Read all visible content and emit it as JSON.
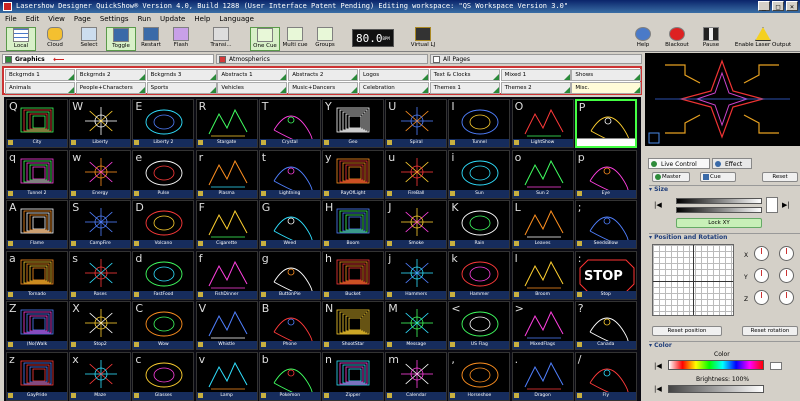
{
  "window": {
    "title": "Lasershow Designer QuickShow®    Version 4.0, Build 1288   (User Interface Patent Pending)   Editing workspace: \"QS Workspace Version 3.0\"",
    "controls": [
      "_",
      "□",
      "×"
    ]
  },
  "menu": [
    "File",
    "Edit",
    "View",
    "Page",
    "Settings",
    "Run",
    "Update",
    "Help",
    "Language"
  ],
  "toolbar": {
    "buttons": [
      {
        "name": "local-button",
        "label": "Local",
        "icon": "grid-icon",
        "active": true
      },
      {
        "name": "cloud-button",
        "label": "Cloud",
        "icon": "cloud-icon",
        "active": false
      },
      {
        "name": "select-button",
        "label": "Select",
        "icon": "cursor-icon",
        "active": false
      },
      {
        "name": "toggle-button",
        "label": "Toggle",
        "icon": "toggle-icon",
        "active": true
      },
      {
        "name": "restart-button",
        "label": "Restart",
        "icon": "restart-icon",
        "active": false
      },
      {
        "name": "flash-button",
        "label": "Flash",
        "icon": "flash-icon",
        "active": false
      },
      {
        "name": "transition-button",
        "label": "Transi...",
        "icon": "transition-icon",
        "active": false
      },
      {
        "name": "one-cue-button",
        "label": "One Cue",
        "icon": "one-cue-icon",
        "active": true
      },
      {
        "name": "multi-cue-button",
        "label": "Multi cue",
        "icon": "multi-cue-icon",
        "active": false
      },
      {
        "name": "groups-button",
        "label": "Groups",
        "icon": "groups-icon",
        "active": false
      }
    ],
    "bpm_value": "80.0",
    "bpm_unit": "BPM",
    "virtual_label": "Virtual LJ",
    "right_buttons": [
      {
        "name": "help-button",
        "label": "Help",
        "icon": "question-icon"
      },
      {
        "name": "blackout-button",
        "label": "Blackout",
        "icon": "blackout-icon"
      },
      {
        "name": "pause-button",
        "label": "Pause",
        "icon": "pause-icon"
      },
      {
        "name": "enable-laser-button",
        "label": "Enable Laser Output",
        "icon": "laser-warning-icon"
      }
    ]
  },
  "page_tabs": [
    {
      "label": "Graphics",
      "color": "#2e8b3a",
      "selected": true
    },
    {
      "label": "Atmospherics",
      "color": "#d43a3a",
      "selected": false
    },
    {
      "label": "All Pages",
      "color": "#ffffff",
      "selected": false
    }
  ],
  "categories": [
    [
      "Bckgrnds 1",
      "Bckgrnds 2",
      "Bckgrnds 3",
      "Abstracts 1",
      "Abstracts 2",
      "Logos",
      "Text & Clocks",
      "Mixed 1",
      "Shows"
    ],
    [
      "Animals",
      "People+Characters",
      "Sports",
      "Vehicles",
      "Music+Dancers",
      "Celebration",
      "Themes 1",
      "Themes 2",
      "Misc."
    ]
  ],
  "cues": [
    [
      {
        "key": "Q",
        "label": "City"
      },
      {
        "key": "W",
        "label": "Liberty"
      },
      {
        "key": "E",
        "label": "Liberty 2"
      },
      {
        "key": "R",
        "label": "Stargate"
      },
      {
        "key": "T",
        "label": "Crystal"
      },
      {
        "key": "Y",
        "label": "Geo"
      },
      {
        "key": "U",
        "label": "Spiral"
      },
      {
        "key": "I",
        "label": "Tunnel"
      },
      {
        "key": "O",
        "label": "LightShow"
      },
      {
        "key": "P",
        "label": ""
      }
    ],
    [
      {
        "key": "q",
        "label": "Tunnel 2"
      },
      {
        "key": "w",
        "label": "Energy"
      },
      {
        "key": "e",
        "label": "Pulse"
      },
      {
        "key": "r",
        "label": "Plasma"
      },
      {
        "key": "t",
        "label": "Lightning"
      },
      {
        "key": "y",
        "label": "RayOfLight"
      },
      {
        "key": "u",
        "label": "FireBall"
      },
      {
        "key": "i",
        "label": "Sun"
      },
      {
        "key": "o",
        "label": "Sun 2"
      },
      {
        "key": "p",
        "label": "Eye"
      }
    ],
    [
      {
        "key": "A",
        "label": "Flame"
      },
      {
        "key": "S",
        "label": "CampFire"
      },
      {
        "key": "D",
        "label": "Volcano"
      },
      {
        "key": "F",
        "label": "Cigarette"
      },
      {
        "key": "G",
        "label": "Weed"
      },
      {
        "key": "H",
        "label": "Boom"
      },
      {
        "key": "J",
        "label": "Smoke"
      },
      {
        "key": "K",
        "label": "Rain"
      },
      {
        "key": "L",
        "label": "Leaves"
      },
      {
        "key": ";",
        "label": "SeedsBlow"
      }
    ],
    [
      {
        "key": "a",
        "label": "Tornado"
      },
      {
        "key": "s",
        "label": "Roses"
      },
      {
        "key": "d",
        "label": "FastFood"
      },
      {
        "key": "f",
        "label": "FishDinner"
      },
      {
        "key": "g",
        "label": "ButtonPie"
      },
      {
        "key": "h",
        "label": "Bucket"
      },
      {
        "key": "j",
        "label": "Hammers"
      },
      {
        "key": "k",
        "label": "Hammer"
      },
      {
        "key": "l",
        "label": "Broom"
      },
      {
        "key": ":",
        "label": "Stop"
      }
    ],
    [
      {
        "key": "Z",
        "label": "(No)Walk"
      },
      {
        "key": "X",
        "label": "Stop2"
      },
      {
        "key": "C",
        "label": "Wow"
      },
      {
        "key": "V",
        "label": "Whistle"
      },
      {
        "key": "B",
        "label": "Phone"
      },
      {
        "key": "N",
        "label": "ShootStar"
      },
      {
        "key": "M",
        "label": "Message"
      },
      {
        "key": "<",
        "label": "US Flag"
      },
      {
        "key": ">",
        "label": "MixedFlags"
      },
      {
        "key": "?",
        "label": "Canada"
      }
    ],
    [
      {
        "key": "z",
        "label": "GayPride"
      },
      {
        "key": "x",
        "label": "Maze"
      },
      {
        "key": "c",
        "label": "Glasses"
      },
      {
        "key": "v",
        "label": "Lamp"
      },
      {
        "key": "b",
        "label": "Pokemon"
      },
      {
        "key": "n",
        "label": "Zipper"
      },
      {
        "key": "m",
        "label": "Calendar"
      },
      {
        "key": ",",
        "label": "Horseshoe"
      },
      {
        "key": ".",
        "label": "Dragon"
      },
      {
        "key": "/",
        "label": "Fly"
      }
    ]
  ],
  "stop_sign_text": "STOP",
  "right_panel": {
    "tabs": [
      {
        "label": "Live Control",
        "color": "#2e8b3a"
      },
      {
        "label": "Effect",
        "color": "#3a6aa8"
      }
    ],
    "sub_tabs": [
      {
        "label": "Master"
      },
      {
        "label": "Cue"
      }
    ],
    "reset_label": "Reset",
    "size_header": "Size",
    "lock_label": "Lock XY",
    "position_header": "Position and Rotation",
    "axis_labels": [
      "X",
      "Y",
      "Z"
    ],
    "reset_position": "Reset position",
    "reset_rotation": "Reset rotation",
    "color_header": "Color",
    "color_label": "Color",
    "brightness_label": "Brightness: 100%",
    "brightness": 1.0
  }
}
